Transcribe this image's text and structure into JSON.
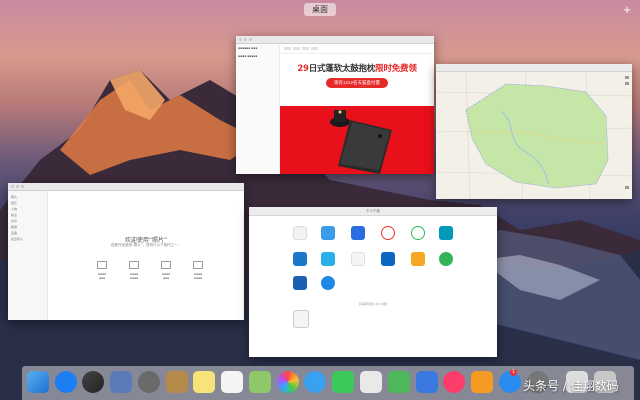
{
  "menubar": {
    "desktop_label": "桌面",
    "add_desktop_glyph": "+"
  },
  "safari": {
    "promo_prefix": "29",
    "promo_text_black": "日式蓬软太鼓抱枕",
    "promo_text_red": "限时免费领",
    "button_label": "现有1212名天猫直付量"
  },
  "photos": {
    "welcome_title": "欢迎使用“照片”",
    "welcome_subtitle": "若要开始使用“照片”，请执行以下操作之一：",
    "sidebar_items": [
      "照片",
      "回忆",
      "人物",
      "地点",
      "共享",
      "相簿",
      "设备",
      "最近导入"
    ]
  },
  "appstore": {
    "toolbar_text": "千人千面",
    "footer_text": "获得所有的 iOS 功能"
  },
  "dock": {
    "badge_count": "1"
  },
  "watermark": "头条号 / 佳翔数码",
  "colors": {
    "accent_red": "#e62a2a",
    "map_green": "#c6e6a8",
    "dock_bg": "#d2d2d7"
  }
}
